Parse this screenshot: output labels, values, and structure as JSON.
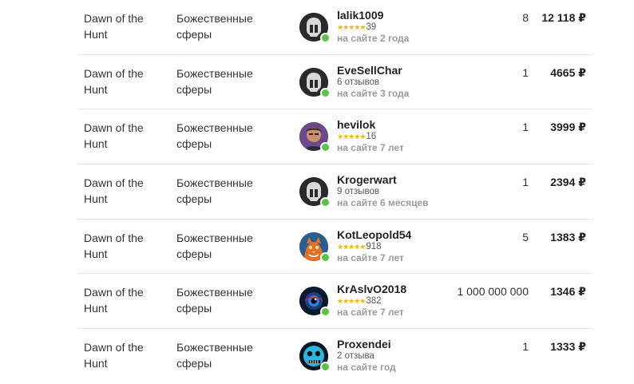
{
  "offers": [
    {
      "game": "Dawn of the Hunt",
      "category": "Божественные сферы",
      "seller": "lalik1009",
      "stars": "★★★★★",
      "reviews": "39",
      "since": "на сайте 2 года",
      "amount": "8",
      "price": "12 118 ₽",
      "avatar": "helmet-avatar"
    },
    {
      "game": "Dawn of the Hunt",
      "category": "Божественные сферы",
      "seller": "EveSellChar",
      "stars": "",
      "reviews": "6 отзывов",
      "since": "на сайте 3 года",
      "amount": "1",
      "price": "4665 ₽",
      "avatar": "helmet-avatar"
    },
    {
      "game": "Dawn of the Hunt",
      "category": "Божественные сферы",
      "seller": "hevilok",
      "stars": "★★★★★",
      "reviews": "16",
      "since": "на сайте 7 лет",
      "amount": "1",
      "price": "3999 ₽",
      "avatar": "person-avatar"
    },
    {
      "game": "Dawn of the Hunt",
      "category": "Божественные сферы",
      "seller": "Krogerwart",
      "stars": "",
      "reviews": "9 отзывов",
      "since": "на сайте 6 месяцев",
      "amount": "1",
      "price": "2394 ₽",
      "avatar": "helmet-avatar"
    },
    {
      "game": "Dawn of the Hunt",
      "category": "Божественные сферы",
      "seller": "KotLeopold54",
      "stars": "★★★★★",
      "reviews": "918",
      "since": "на сайте 7 лет",
      "amount": "5",
      "price": "1383 ₽",
      "avatar": "cat-avatar"
    },
    {
      "game": "Dawn of the Hunt",
      "category": "Божественные сферы",
      "seller": "KrAslvO2018",
      "stars": "★★★★★",
      "reviews": "382",
      "since": "на сайте 7 лет",
      "amount": "1 000 000 000",
      "price": "1346 ₽",
      "avatar": "eye-avatar"
    },
    {
      "game": "Dawn of the Hunt",
      "category": "Божественные сферы",
      "seller": "Proxendei",
      "stars": "",
      "reviews": "2 отзыва",
      "since": "на сайте год",
      "amount": "1",
      "price": "1333 ₽",
      "avatar": "mask-avatar"
    }
  ],
  "colors": {
    "online": "#5bc14a",
    "stars": "#f2b600",
    "divider": "#e5e5e5"
  }
}
